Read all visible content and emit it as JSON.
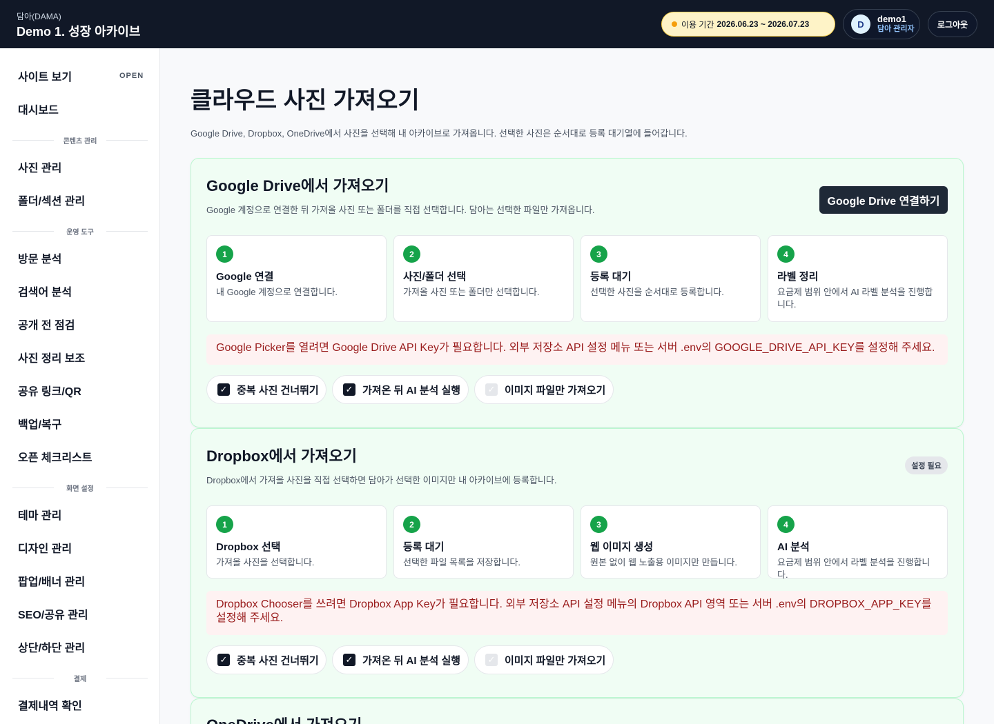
{
  "header": {
    "brand_sub": "담아(DAMA)",
    "brand_title": "Demo 1. 성장 아카이브",
    "period_label": "이용 기간",
    "period_value": "2026.06.23 ~ 2026.07.23",
    "user_initial": "D",
    "user_name": "demo1",
    "user_role": "담아 관리자",
    "logout": "로그아웃"
  },
  "sidebar": {
    "site_view": "사이트 보기",
    "site_badge": "OPEN",
    "dashboard": "대시보드",
    "sec_content": "콘텐츠 관리",
    "photo_manage": "사진 관리",
    "folder_manage": "폴더/섹션 관리",
    "sec_ops": "운영 도구",
    "visits": "방문 분석",
    "search_terms": "검색어 분석",
    "precheck": "공개 전 점검",
    "photo_assist": "사진 정리 보조",
    "share_qr": "공유 링크/QR",
    "backup": "백업/복구",
    "open_check": "오픈 체크리스트",
    "sec_screen": "화면 설정",
    "theme": "테마 관리",
    "design": "디자인 관리",
    "popup": "팝업/배너 관리",
    "seo": "SEO/공유 관리",
    "header_footer": "상단/하단 관리",
    "sec_payment": "결제",
    "payments": "결제내역 확인"
  },
  "main": {
    "title": "클라우드 사진 가져오기",
    "desc": "Google Drive, Dropbox, OneDrive에서 사진을 선택해 내 아카이브로 가져옵니다. 선택한 사진은 순서대로 등록 대기열에 들어갑니다."
  },
  "google": {
    "title": "Google Drive에서 가져오기",
    "desc": "Google 계정으로 연결한 뒤 가져올 사진 또는 폴더를 직접 선택합니다. 담아는 선택한 파일만 가져옵니다.",
    "connect": "Google Drive 연결하기",
    "steps": [
      {
        "num": "1",
        "title": "Google 연결",
        "desc": "내 Google 계정으로 연결합니다."
      },
      {
        "num": "2",
        "title": "사진/폴더 선택",
        "desc": "가져올 사진 또는 폴더만 선택합니다."
      },
      {
        "num": "3",
        "title": "등록 대기",
        "desc": "선택한 사진을 순서대로 등록합니다."
      },
      {
        "num": "4",
        "title": "라벨 정리",
        "desc": "요금제 범위 안에서 AI 라벨 분석을 진행합니다."
      }
    ],
    "alert": "Google Picker를 열려면 Google Drive API Key가 필요합니다. 외부 저장소 API 설정 메뉴 또는 서버 .env의 GOOGLE_DRIVE_API_KEY를 설정해 주세요.",
    "options": [
      "중복 사진 건너뛰기",
      "가져온 뒤 AI 분석 실행",
      "이미지 파일만 가져오기"
    ]
  },
  "dropbox": {
    "title": "Dropbox에서 가져오기",
    "desc": "Dropbox에서 가져올 사진을 직접 선택하면 담아가 선택한 이미지만 내 아카이브에 등록합니다.",
    "badge": "설정 필요",
    "steps": [
      {
        "num": "1",
        "title": "Dropbox 선택",
        "desc": "가져올 사진을 선택합니다."
      },
      {
        "num": "2",
        "title": "등록 대기",
        "desc": "선택한 파일 목록을 저장합니다."
      },
      {
        "num": "3",
        "title": "웹 이미지 생성",
        "desc": "원본 없이 웹 노출용 이미지만 만듭니다."
      },
      {
        "num": "4",
        "title": "AI 분석",
        "desc": "요금제 범위 안에서 라벨 분석을 진행합니다."
      }
    ],
    "alert": "Dropbox Chooser를 쓰려면 Dropbox App Key가 필요합니다. 외부 저장소 API 설정 메뉴의 Dropbox API 영역 또는 서버 .env의 DROPBOX_APP_KEY를 설정해 주세요.",
    "options": [
      "중복 사진 건너뛰기",
      "가져온 뒤 AI 분석 실행",
      "이미지 파일만 가져오기"
    ]
  },
  "onedrive": {
    "title": "OneDrive에서 가져오기"
  },
  "icons": {
    "check": "checkmark-icon"
  }
}
